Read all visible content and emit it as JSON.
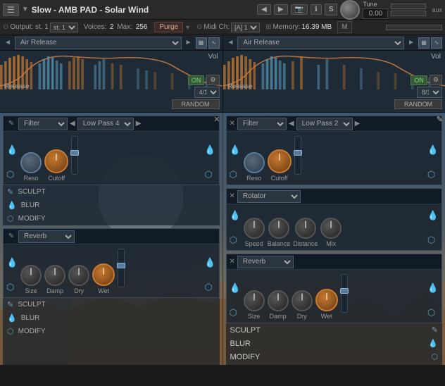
{
  "topbar": {
    "title": "Slow - AMB PAD - Solar Wind",
    "output": "Output: st. 1",
    "voices_label": "Voices:",
    "voices_val": "2",
    "max_label": "Max:",
    "max_val": "256",
    "midi_label": "Midi Ch:",
    "midi_val": "[A] 1",
    "memory_label": "Memory:",
    "memory_val": "16.39 MB",
    "purge_label": "Purge",
    "tune_label": "Tune",
    "tune_val": "0.00",
    "s_label": "S",
    "m_label": "M"
  },
  "env_left": {
    "dropdown": "Air Release",
    "vol_label": "Vol",
    "toggle_on": "ON",
    "div": "4/1",
    "random": "RANDOM",
    "release_text": "Release"
  },
  "env_right": {
    "dropdown": "Air Release",
    "vol_label": "Vol",
    "toggle_on": "ON",
    "div": "8/1",
    "random": "RANDOM",
    "release_text": "Release"
  },
  "filter_left": {
    "module_label": "Filter",
    "type_label": "Low Pass 4",
    "reso_label": "Reso",
    "cutoff_label": "Cutoff",
    "sculpt": "SCULPT",
    "blur": "BLUR",
    "modify": "MODIFY"
  },
  "filter_right": {
    "module_label": "Filter",
    "type_label": "Low Pass 2",
    "reso_label": "Reso",
    "cutoff_label": "Cutoff"
  },
  "rotator_right": {
    "module_label": "Rotator",
    "speed_label": "Speed",
    "balance_label": "Balance",
    "distance_label": "Distance",
    "mix_label": "Mix"
  },
  "reverb_left": {
    "module_label": "Reverb",
    "size_label": "Size",
    "damp_label": "Damp",
    "dry_label": "Dry",
    "wet_label": "Wet",
    "sculpt": "SCULPT",
    "blur": "BLUR",
    "modify": "MODIFY"
  },
  "reverb_right": {
    "module_label": "Reverb",
    "size_label": "Size",
    "damp_label": "Damp",
    "dry_label": "Dry",
    "wet_label": "Wet",
    "sculpt": "SCULPT",
    "blur": "BLUR",
    "modify": "MODIFY"
  },
  "icons": {
    "pencil": "✎",
    "close": "✕",
    "arrow_left": "◀",
    "arrow_right": "▶",
    "gear": "⚙",
    "drop": "💧",
    "hex": "⬡",
    "nav_left": "◄",
    "nav_right": "►"
  }
}
